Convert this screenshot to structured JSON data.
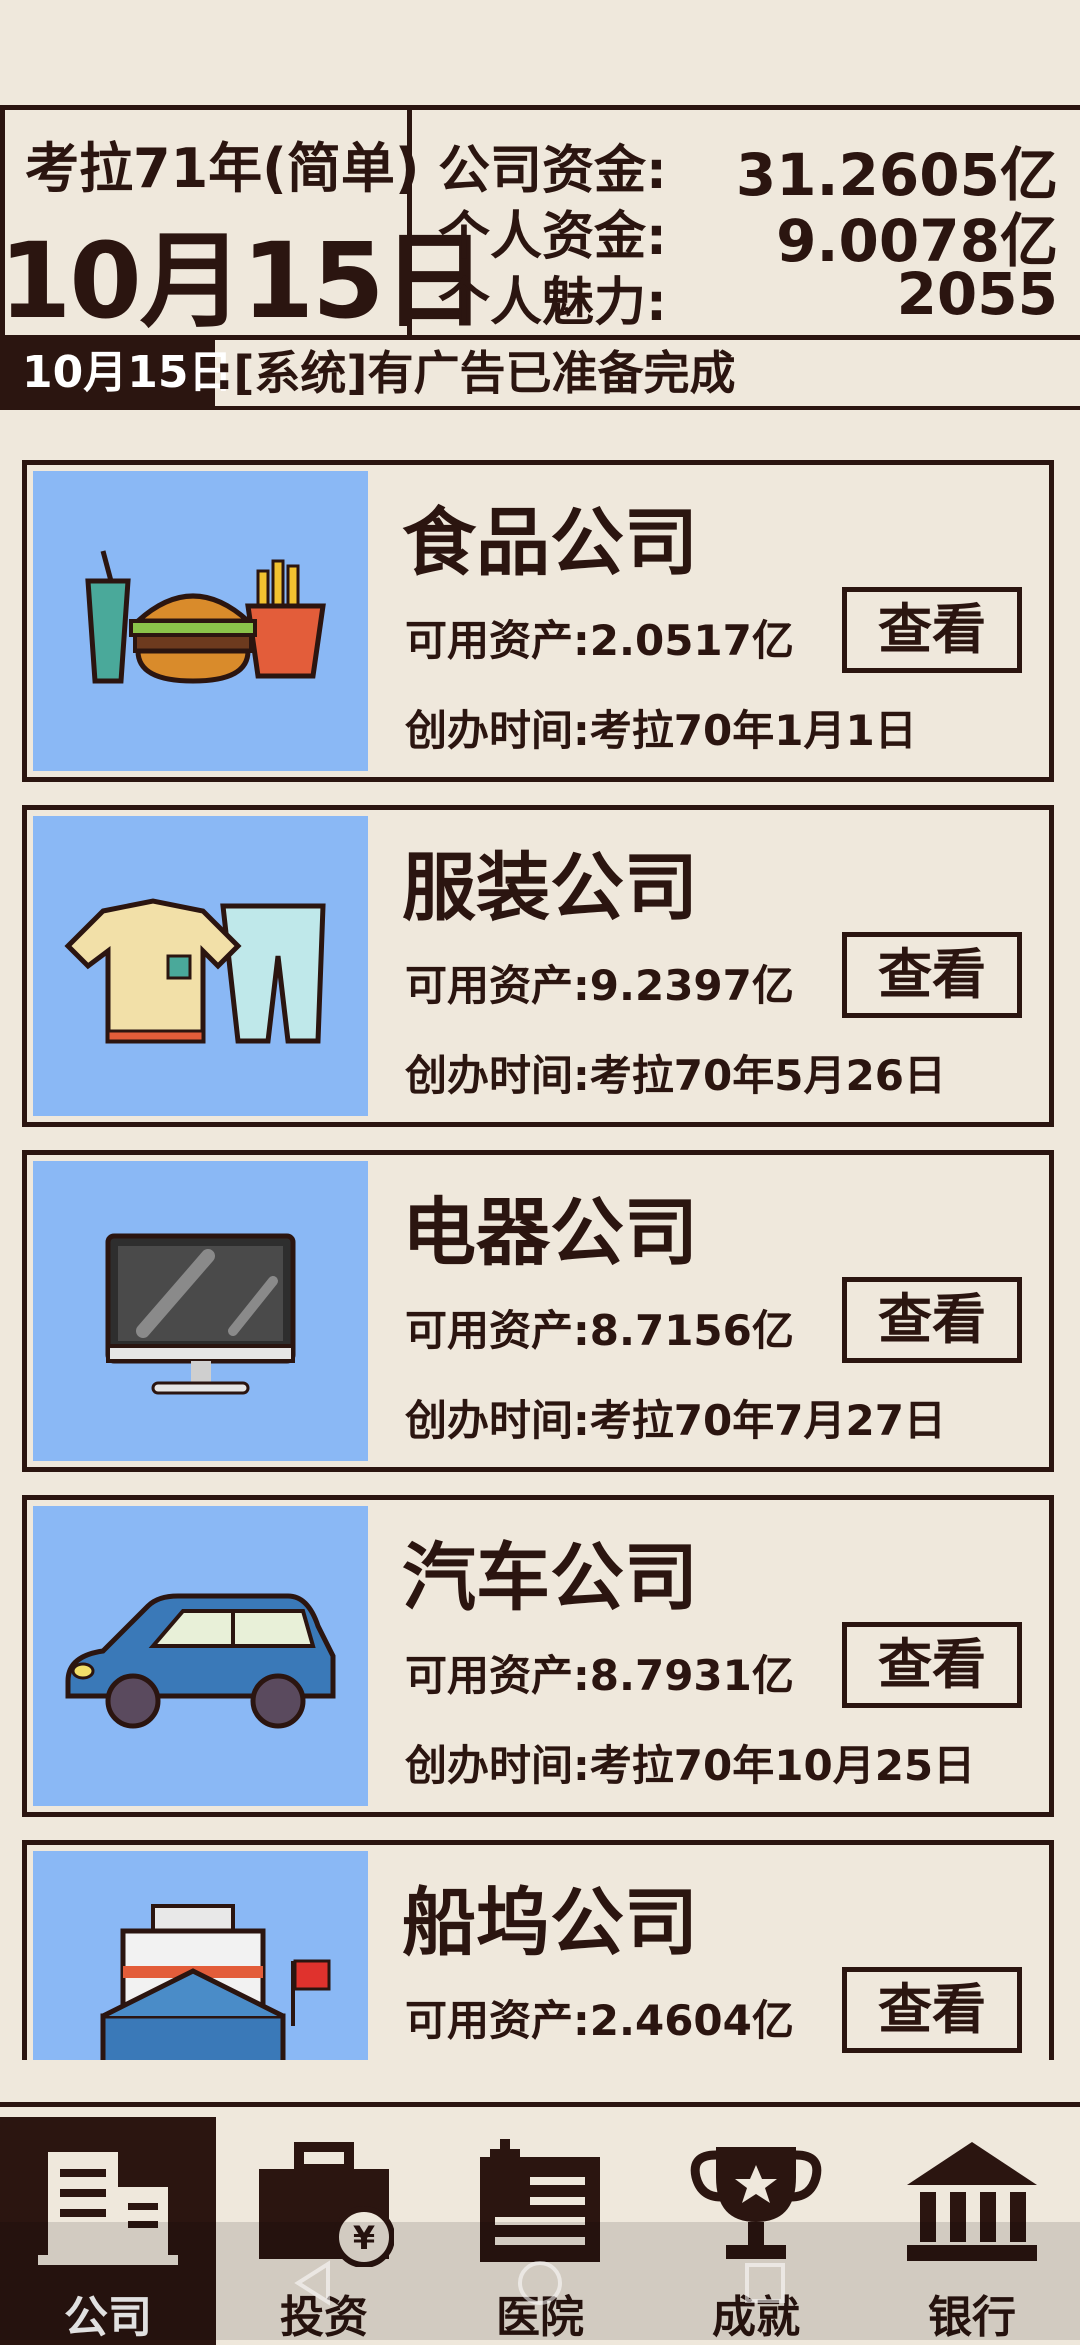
{
  "header": {
    "year_label": "考拉71年(简单)",
    "date": "10月15日",
    "stats": [
      {
        "label": "公司资金:",
        "value": "31.2605亿"
      },
      {
        "label": "个人资金:",
        "value": "9.0078亿"
      },
      {
        "label": "个人魅力:",
        "value": "2055"
      }
    ]
  },
  "news": {
    "date": "10月15日",
    "text": ":[系统]有广告已准备完成"
  },
  "companies": [
    {
      "name": "食品公司",
      "assets": "可用资产:2.0517亿",
      "founded": "创办时间:考拉70年1月1日",
      "button": "查看",
      "icon": "burger-fries-icon"
    },
    {
      "name": "服装公司",
      "assets": "可用资产:9.2397亿",
      "founded": "创办时间:考拉70年5月26日",
      "button": "查看",
      "icon": "shirt-pants-icon"
    },
    {
      "name": "电器公司",
      "assets": "可用资产:8.7156亿",
      "founded": "创办时间:考拉70年7月27日",
      "button": "查看",
      "icon": "monitor-icon"
    },
    {
      "name": "汽车公司",
      "assets": "可用资产:8.7931亿",
      "founded": "创办时间:考拉70年10月25日",
      "button": "查看",
      "icon": "car-icon"
    },
    {
      "name": "船坞公司",
      "assets": "可用资产:2.4604亿",
      "founded": "",
      "button": "查看",
      "icon": "ship-icon"
    }
  ],
  "tabs": [
    {
      "label": "公司",
      "icon": "building-icon",
      "active": true
    },
    {
      "label": "投资",
      "icon": "briefcase-yen-icon",
      "active": false
    },
    {
      "label": "医院",
      "icon": "hospital-icon",
      "active": false
    },
    {
      "label": "成就",
      "icon": "trophy-icon",
      "active": false
    },
    {
      "label": "银行",
      "icon": "bank-icon",
      "active": false
    }
  ],
  "colors": {
    "background": "#efe8dc",
    "ink": "#2b1510",
    "card_image_bg": "#8ab8f5"
  }
}
